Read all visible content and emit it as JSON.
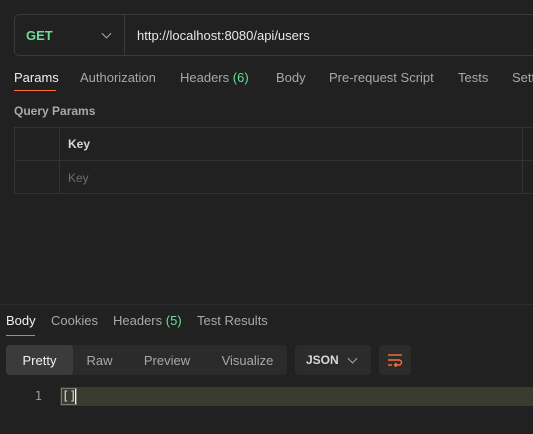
{
  "request": {
    "method": "GET",
    "url": "http://localhost:8080/api/users"
  },
  "request_tabs": [
    {
      "label": "Params",
      "active": true
    },
    {
      "label": "Authorization"
    },
    {
      "label": "Headers",
      "count": "(6)"
    },
    {
      "label": "Body"
    },
    {
      "label": "Pre-request Script"
    },
    {
      "label": "Tests"
    },
    {
      "label": "Setti"
    }
  ],
  "query_params": {
    "section_label": "Query Params",
    "header_key": "Key",
    "key_placeholder": "Key"
  },
  "response_tabs": [
    {
      "label": "Body",
      "active": true
    },
    {
      "label": "Cookies"
    },
    {
      "label": "Headers",
      "count": "(5)"
    },
    {
      "label": "Test Results"
    }
  ],
  "format_buttons": [
    {
      "label": "Pretty",
      "active": true
    },
    {
      "label": "Raw"
    },
    {
      "label": "Preview"
    },
    {
      "label": "Visualize"
    }
  ],
  "language_select": "JSON",
  "response_body": {
    "line_number": "1",
    "code": "[]"
  },
  "colors": {
    "method_get": "#6bdd9a",
    "accent": "#ff6c37",
    "background": "#212121"
  }
}
